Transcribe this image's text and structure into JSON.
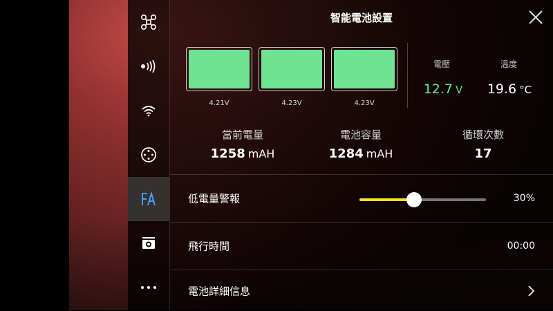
{
  "title": "智能電池設置",
  "sidebar": {
    "items": [
      {
        "icon": "drone-icon",
        "active": false
      },
      {
        "icon": "signal-icon",
        "active": false
      },
      {
        "icon": "wifi-icon",
        "active": false
      },
      {
        "icon": "control-icon",
        "active": false
      },
      {
        "icon": "battery-settings-icon",
        "active": true
      },
      {
        "icon": "camera-icon",
        "active": false
      },
      {
        "icon": "more-icon",
        "active": false
      }
    ]
  },
  "cells": [
    {
      "voltage": "4.21V"
    },
    {
      "voltage": "4.23V"
    },
    {
      "voltage": "4.23V"
    }
  ],
  "voltage": {
    "label": "電壓",
    "value": "12.7",
    "unit": "V"
  },
  "temperature": {
    "label": "溫度",
    "value": "19.6",
    "unit": "°C"
  },
  "info": {
    "current_charge": {
      "label": "當前電量",
      "value": "1258",
      "unit": "mAH"
    },
    "capacity": {
      "label": "電池容量",
      "value": "1284",
      "unit": "mAH"
    },
    "cycles": {
      "label": "循環次數",
      "value": "17"
    }
  },
  "low_battery_warning": {
    "label": "低電量警報",
    "value": "30%",
    "fraction": 0.43
  },
  "flight_time": {
    "label": "飛行時間",
    "value": "00:00"
  },
  "battery_details": {
    "label": "電池詳細信息"
  },
  "colors": {
    "accent_green": "#6fe391",
    "slider_yellow": "#f5e12d"
  }
}
